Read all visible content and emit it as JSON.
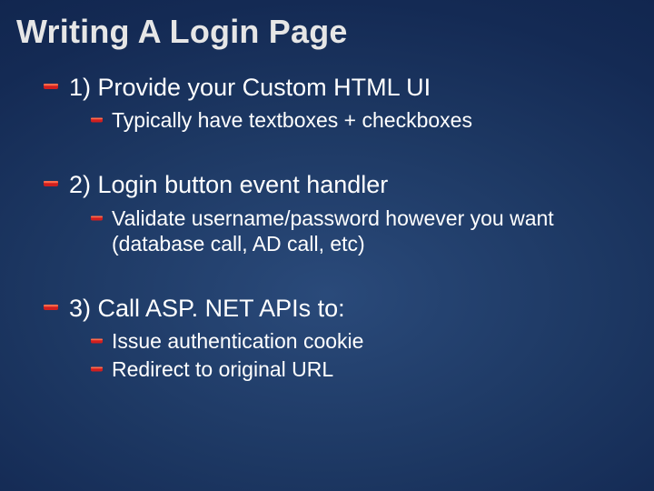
{
  "title": "Writing A Login Page",
  "items": [
    {
      "text": "1) Provide your Custom HTML UI",
      "sub": [
        "Typically have textboxes + checkboxes"
      ]
    },
    {
      "text": "2) Login button event handler",
      "sub": [
        "Validate username/password however you want (database call, AD call, etc)"
      ]
    },
    {
      "text": "3) Call ASP. NET APIs to:",
      "sub": [
        "Issue authentication cookie",
        "Redirect to original URL"
      ]
    }
  ]
}
